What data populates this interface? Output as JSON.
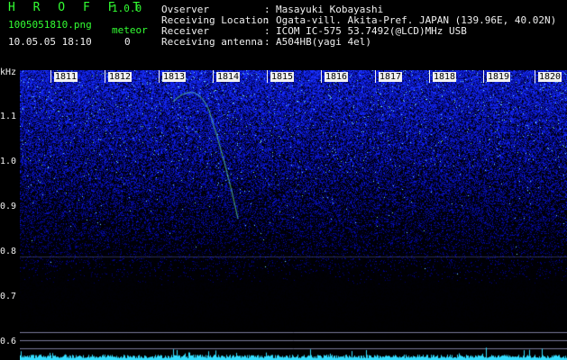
{
  "app": {
    "title": "H R O F F T",
    "version": "1.0.0",
    "filename": "1005051810.png",
    "datetime": "10.05.05 18:10",
    "meteor_label": "meteor",
    "meteor_count": "0"
  },
  "info": {
    "observer_label": "Ovserver",
    "observer_value": "Masayuki Kobayashi",
    "location_label": "Receiving Location",
    "location_value": "Ogata-vill. Akita-Pref. JAPAN (139.96E, 40.02N)",
    "receiver_label": "Receiver",
    "receiver_value": "ICOM IC-575 53.7492(@LCD)MHz USB",
    "antenna_label": "Receiving antenna",
    "antenna_value": "A504HB(yagi 4el)",
    "separator": ":"
  },
  "axes": {
    "y_unit": "kHz",
    "y_ticks": [
      "1.1",
      "1.0",
      "0.9",
      "0.8",
      "0.7",
      "0.6"
    ],
    "x_ticks": [
      "1811",
      "1812",
      "1813",
      "1814",
      "1815",
      "1816",
      "1817",
      "1818",
      "1819",
      "1820"
    ]
  },
  "colors": {
    "background": "#000000",
    "text_green": "#33ff33",
    "text_white": "#f0f0f0",
    "signal_low": "#000010",
    "signal_high": "#2f4dff",
    "meteor_trail": "#55ff77",
    "spectrum_line": "#33ddff"
  }
}
